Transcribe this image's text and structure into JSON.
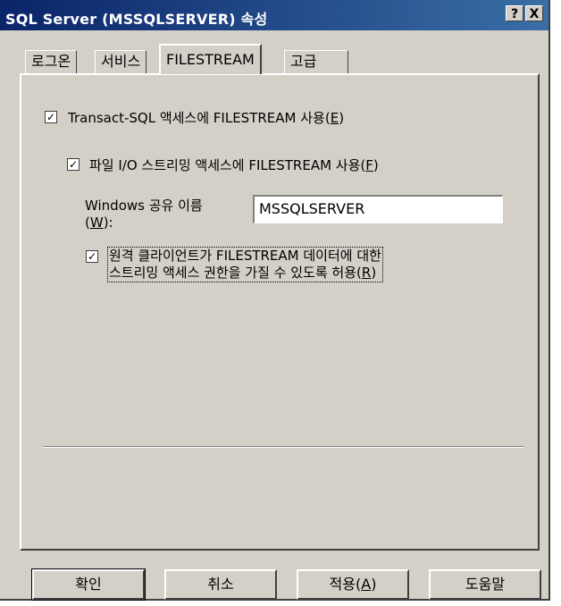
{
  "window": {
    "title": "SQL Server (MSSQLSERVER) 속성",
    "help_btn": "?",
    "close_btn": "X"
  },
  "tabs": [
    {
      "label": "로그온",
      "active": false
    },
    {
      "label": "서비스",
      "active": false
    },
    {
      "label": "FILESTREAM",
      "active": true
    },
    {
      "label": "고급",
      "active": false
    }
  ],
  "filestream": {
    "enable_tsql": {
      "label": "Transact-SQL 액세스에 FILESTREAM 사용",
      "mnemonic": "E",
      "checked": true
    },
    "enable_file_io": {
      "label": "파일 I/O 스트리밍 액세스에 FILESTREAM 사용",
      "mnemonic": "F",
      "checked": true
    },
    "share_name": {
      "label_line1": "Windows 공유 이름",
      "label_mnemonic": "W",
      "value": "MSSQLSERVER"
    },
    "allow_remote": {
      "line1": "원격 클라이언트가 FILESTREAM 데이터에 대한",
      "line2": "스트리밍 액세스 권한을 가질 수 있도록 허용",
      "mnemonic": "R",
      "checked": true
    }
  },
  "buttons": {
    "ok": "확인",
    "cancel": "취소",
    "apply_label": "적용",
    "apply_mnemonic": "A",
    "help": "도움말"
  },
  "colors": {
    "title_start": "#0a246a",
    "title_end": "#3a6ea5",
    "face": "#d4d0c8"
  }
}
